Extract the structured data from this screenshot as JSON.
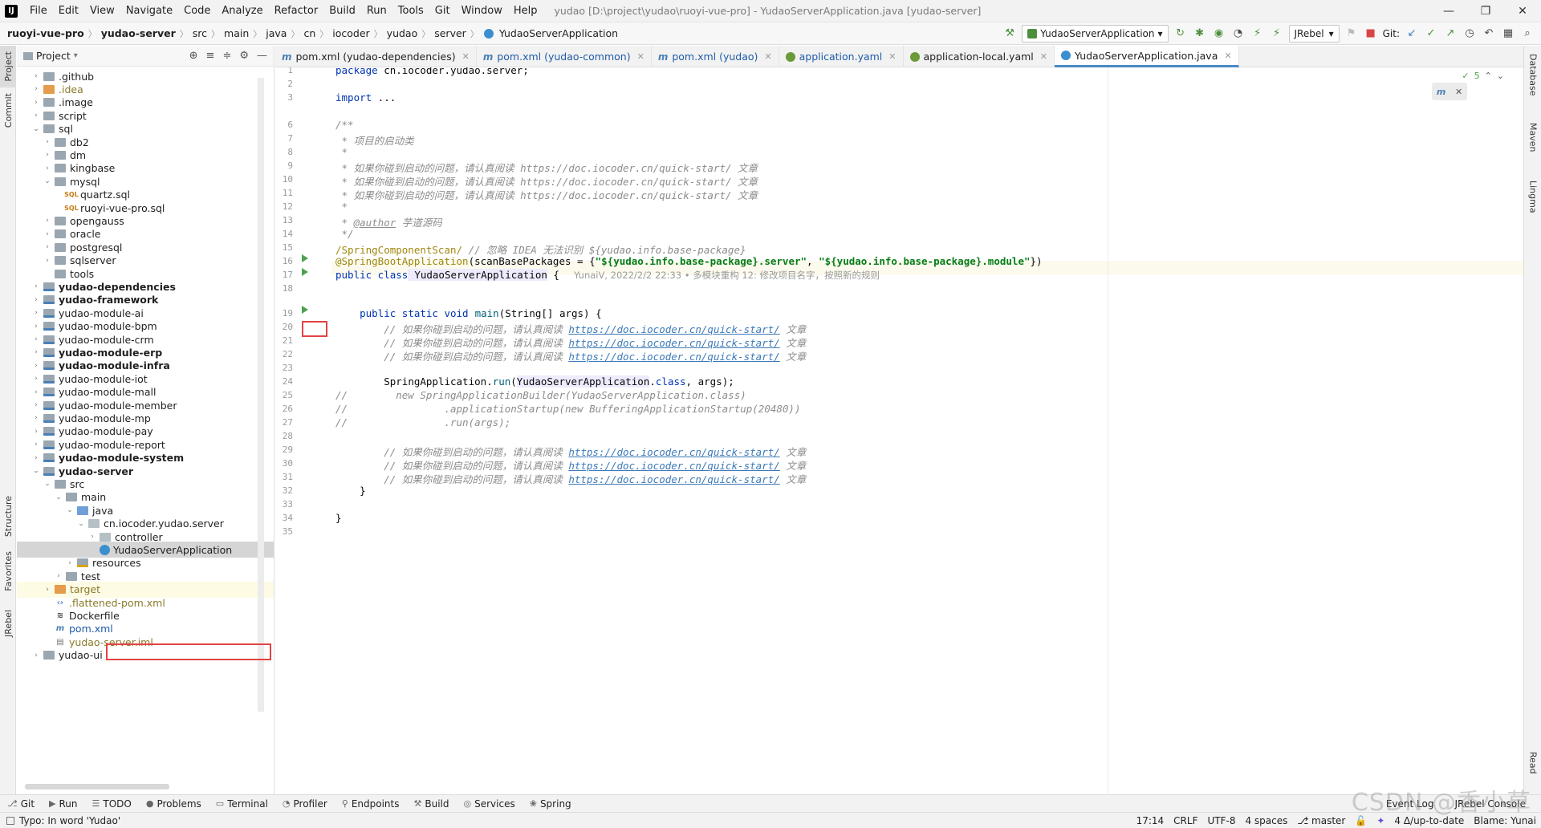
{
  "menubar": {
    "items": [
      "File",
      "Edit",
      "View",
      "Navigate",
      "Code",
      "Analyze",
      "Refactor",
      "Build",
      "Run",
      "Tools",
      "Git",
      "Window",
      "Help"
    ],
    "window_title": "yudao [D:\\project\\yudao\\ruoyi-vue-pro] - YudaoServerApplication.java [yudao-server]",
    "controls": [
      "—",
      "❐",
      "✕"
    ]
  },
  "navbar": {
    "crumbs": [
      "ruoyi-vue-pro",
      "yudao-server",
      "src",
      "main",
      "java",
      "cn",
      "iocoder",
      "yudao",
      "server",
      "YudaoServerApplication"
    ],
    "run_config": "YudaoServerApplication",
    "jrebel": "JRebel",
    "git_label": "Git:"
  },
  "left_strip": {
    "tabs": [
      "Project",
      "Commit",
      "Structure",
      "Favorites",
      "JRebel"
    ]
  },
  "right_strip": {
    "tabs": [
      "Database",
      "Maven",
      "Lingma",
      "Read"
    ]
  },
  "project": {
    "title": "Project",
    "tree": [
      {
        "label": ".github",
        "depth": 1,
        "arrow": ">",
        "icon": "folder"
      },
      {
        "label": ".idea",
        "depth": 1,
        "arrow": ">",
        "icon": "excl",
        "style": "olive"
      },
      {
        "label": ".image",
        "depth": 1,
        "arrow": ">",
        "icon": "folder"
      },
      {
        "label": "script",
        "depth": 1,
        "arrow": ">",
        "icon": "folder"
      },
      {
        "label": "sql",
        "depth": 1,
        "arrow": "v",
        "icon": "folder"
      },
      {
        "label": "db2",
        "depth": 2,
        "arrow": ">",
        "icon": "folder"
      },
      {
        "label": "dm",
        "depth": 2,
        "arrow": ">",
        "icon": "folder"
      },
      {
        "label": "kingbase",
        "depth": 2,
        "arrow": ">",
        "icon": "folder"
      },
      {
        "label": "mysql",
        "depth": 2,
        "arrow": "v",
        "icon": "folder"
      },
      {
        "label": "quartz.sql",
        "depth": 3,
        "arrow": "",
        "icon": "sql"
      },
      {
        "label": "ruoyi-vue-pro.sql",
        "depth": 3,
        "arrow": "",
        "icon": "sql"
      },
      {
        "label": "opengauss",
        "depth": 2,
        "arrow": ">",
        "icon": "folder"
      },
      {
        "label": "oracle",
        "depth": 2,
        "arrow": ">",
        "icon": "folder"
      },
      {
        "label": "postgresql",
        "depth": 2,
        "arrow": ">",
        "icon": "folder"
      },
      {
        "label": "sqlserver",
        "depth": 2,
        "arrow": ">",
        "icon": "folder"
      },
      {
        "label": "tools",
        "depth": 2,
        "arrow": "",
        "icon": "folder"
      },
      {
        "label": "yudao-dependencies",
        "depth": 1,
        "arrow": ">",
        "icon": "module",
        "style": "bold"
      },
      {
        "label": "yudao-framework",
        "depth": 1,
        "arrow": ">",
        "icon": "module",
        "style": "bold"
      },
      {
        "label": "yudao-module-ai",
        "depth": 1,
        "arrow": ">",
        "icon": "module"
      },
      {
        "label": "yudao-module-bpm",
        "depth": 1,
        "arrow": ">",
        "icon": "module"
      },
      {
        "label": "yudao-module-crm",
        "depth": 1,
        "arrow": ">",
        "icon": "module"
      },
      {
        "label": "yudao-module-erp",
        "depth": 1,
        "arrow": ">",
        "icon": "module",
        "style": "bold"
      },
      {
        "label": "yudao-module-infra",
        "depth": 1,
        "arrow": ">",
        "icon": "module",
        "style": "bold"
      },
      {
        "label": "yudao-module-iot",
        "depth": 1,
        "arrow": ">",
        "icon": "module"
      },
      {
        "label": "yudao-module-mall",
        "depth": 1,
        "arrow": ">",
        "icon": "module"
      },
      {
        "label": "yudao-module-member",
        "depth": 1,
        "arrow": ">",
        "icon": "module"
      },
      {
        "label": "yudao-module-mp",
        "depth": 1,
        "arrow": ">",
        "icon": "module"
      },
      {
        "label": "yudao-module-pay",
        "depth": 1,
        "arrow": ">",
        "icon": "module"
      },
      {
        "label": "yudao-module-report",
        "depth": 1,
        "arrow": ">",
        "icon": "module"
      },
      {
        "label": "yudao-module-system",
        "depth": 1,
        "arrow": ">",
        "icon": "module",
        "style": "bold"
      },
      {
        "label": "yudao-server",
        "depth": 1,
        "arrow": "v",
        "icon": "module",
        "style": "bold"
      },
      {
        "label": "src",
        "depth": 2,
        "arrow": "v",
        "icon": "folder"
      },
      {
        "label": "main",
        "depth": 3,
        "arrow": "v",
        "icon": "folder"
      },
      {
        "label": "java",
        "depth": 4,
        "arrow": "v",
        "icon": "src"
      },
      {
        "label": "cn.iocoder.yudao.server",
        "depth": 5,
        "arrow": "v",
        "icon": "pkg"
      },
      {
        "label": "controller",
        "depth": 6,
        "arrow": ">",
        "icon": "pkg"
      },
      {
        "label": "YudaoServerApplication",
        "depth": 6,
        "arrow": "",
        "icon": "java",
        "selected": true
      },
      {
        "label": "resources",
        "depth": 4,
        "arrow": ">",
        "icon": "res"
      },
      {
        "label": "test",
        "depth": 3,
        "arrow": ">",
        "icon": "folder"
      },
      {
        "label": "target",
        "depth": 2,
        "arrow": ">",
        "icon": "excl",
        "style": "olive",
        "hl": true
      },
      {
        "label": ".flattened-pom.xml",
        "depth": 2,
        "arrow": "",
        "icon": "xml",
        "style": "olive"
      },
      {
        "label": "Dockerfile",
        "depth": 2,
        "arrow": "",
        "icon": "docker"
      },
      {
        "label": "pom.xml",
        "depth": 2,
        "arrow": "",
        "icon": "m",
        "style": "blue"
      },
      {
        "label": "yudao-server.iml",
        "depth": 2,
        "arrow": "",
        "icon": "iml",
        "style": "olive"
      },
      {
        "label": "yudao-ui",
        "depth": 1,
        "arrow": ">",
        "icon": "folder"
      }
    ]
  },
  "editor_tabs": [
    {
      "label": "pom.xml (yudao-dependencies)",
      "icon": "m",
      "active": false
    },
    {
      "label": "pom.xml (yudao-common)",
      "icon": "m",
      "active": false,
      "style": "blue"
    },
    {
      "label": "pom.xml (yudao)",
      "icon": "m",
      "active": false,
      "style": "blue"
    },
    {
      "label": "application.yaml",
      "icon": "y",
      "active": false,
      "style": "blue"
    },
    {
      "label": "application-local.yaml",
      "icon": "y",
      "active": false
    },
    {
      "label": "YudaoServerApplication.java",
      "icon": "j",
      "active": true
    }
  ],
  "editor": {
    "inspection_count": "5",
    "line_numbers": [
      "1",
      "2",
      "3",
      "6",
      "7",
      "8",
      "9",
      "10",
      "11",
      "12",
      "13",
      "14",
      "15",
      "16",
      "17",
      "18",
      "19",
      "20",
      "21",
      "22",
      "23",
      "24",
      "25",
      "26",
      "27",
      "28",
      "29",
      "30",
      "31",
      "32",
      "33",
      "34",
      "35"
    ],
    "code": {
      "l1_kw": "package",
      "l1_rest": " cn.iocoder.yudao.server;",
      "l3_kw": "import",
      "l3_rest": " ...",
      "l6": "/**",
      "l7": " * 项目的启动类",
      "l8": " *",
      "l9": " * 如果你碰到启动的问题，请认真阅读 https://doc.iocoder.cn/quick-start/ 文章",
      "l10": " * 如果你碰到启动的问题，请认真阅读 https://doc.iocoder.cn/quick-start/ 文章",
      "l11": " * 如果你碰到启动的问题，请认真阅读 https://doc.iocoder.cn/quick-start/ 文章",
      "l12": " *",
      "l13_pre": " * ",
      "l13_tag": "@author",
      "l13_post": " 芋道源码",
      "l14": " */",
      "l15_code": "/SpringComponentScan/",
      "l15_cm": " // 忽略 IDEA 无法识别 ${yudao.info.base-package}",
      "l16_ann": "@SpringBootApplication",
      "l16_mid": "(scanBasePackages = {",
      "l16_s1": "\"${yudao.info.base-package}.server\"",
      "l16_comma": ", ",
      "l16_s2": "\"${yudao.info.base-package}.module\"",
      "l16_end": "})",
      "l17_kw": "public class",
      "l17_cls": "YudaoServerApplication",
      "l17_end": " {",
      "l17_blame": "YunaiV, 2022/2/2 22:33 • 多模块重构 12: 修改项目名字，按照新的规则",
      "l19_kw": "public static void",
      "l19_meth": "main",
      "l19_rest": "(String[] args) {",
      "l20_cm": "// 如果你碰到启动的问题，请认真阅读 ",
      "l20_link": "https://doc.iocoder.cn/quick-start/",
      "l20_tail": " 文章",
      "l24_a": "SpringApplication.",
      "l24_meth": "run",
      "l24_b": "(",
      "l24_cls": "YudaoServerApplication",
      "l24_c": ".",
      "l24_kw": "class",
      "l24_d": ", args);",
      "l25": "//        new SpringApplicationBuilder(YudaoServerApplication.class)",
      "l26": "//                .applicationStartup(new BufferingApplicationStartup(20480))",
      "l27": "//                .run(args);",
      "l32": "    }",
      "l34": "}"
    }
  },
  "bottom_tabs": [
    "Git",
    "Run",
    "TODO",
    "Problems",
    "Terminal",
    "Profiler",
    "Endpoints",
    "Build",
    "Services",
    "Spring"
  ],
  "bottom_right": [
    "Event Log",
    "JRebel Console"
  ],
  "status": {
    "message": "Typo: In word 'Yudao'",
    "position": "17:14",
    "line_sep": "CRLF",
    "encoding": "UTF-8",
    "indent": "4 spaces",
    "branch": "master",
    "vcs": "4 Δ/up-to-date",
    "blame": "Blame: Yunai",
    "watermark": "CSDN @香小草"
  }
}
